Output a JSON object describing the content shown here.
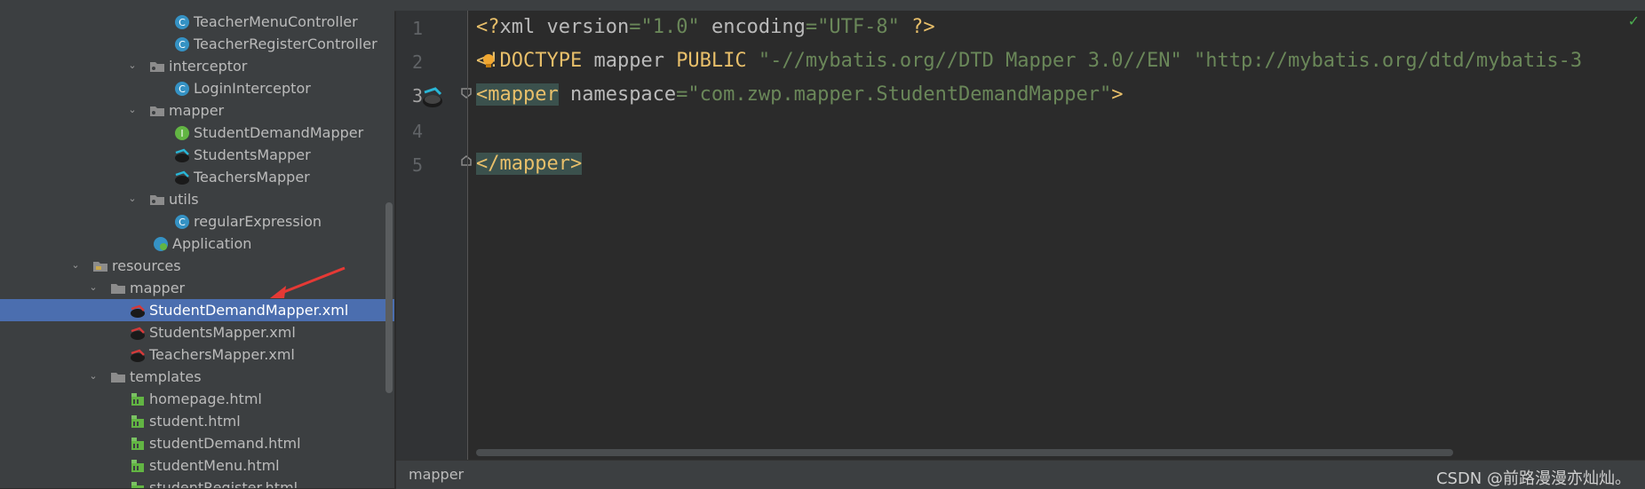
{
  "tree": [
    {
      "label": "TeacherMenuController",
      "indent": 196,
      "icon": "class-icon",
      "arrow": "",
      "selected": false
    },
    {
      "label": "TeacherRegisterController",
      "indent": 196,
      "icon": "class-icon",
      "arrow": "",
      "selected": false
    },
    {
      "label": "interceptor",
      "indent": 168,
      "icon": "package-folder-icon",
      "arrow": "v",
      "selected": false
    },
    {
      "label": "LoginInterceptor",
      "indent": 196,
      "icon": "class-icon",
      "arrow": "",
      "selected": false
    },
    {
      "label": "mapper",
      "indent": 168,
      "icon": "package-folder-icon",
      "arrow": "v",
      "selected": false
    },
    {
      "label": "StudentDemandMapper",
      "indent": 196,
      "icon": "interface-icon",
      "arrow": "",
      "selected": false
    },
    {
      "label": "StudentsMapper",
      "indent": 196,
      "icon": "mybatis-mapper-icon",
      "arrow": "",
      "selected": false
    },
    {
      "label": "TeachersMapper",
      "indent": 196,
      "icon": "mybatis-mapper-icon",
      "arrow": "",
      "selected": false
    },
    {
      "label": "utils",
      "indent": 168,
      "icon": "package-folder-icon",
      "arrow": "v",
      "selected": false
    },
    {
      "label": "regularExpression",
      "indent": 196,
      "icon": "class-icon",
      "arrow": "",
      "selected": false
    },
    {
      "label": "Application",
      "indent": 172,
      "icon": "spring-boot-app-icon",
      "arrow": "",
      "selected": false
    },
    {
      "label": "resources",
      "indent": 104,
      "icon": "resources-folder-icon",
      "arrow": "v",
      "selected": false
    },
    {
      "label": "mapper",
      "indent": 124,
      "icon": "folder-icon",
      "arrow": "v",
      "selected": false
    },
    {
      "label": "StudentDemandMapper.xml",
      "indent": 146,
      "icon": "mybatis-xml-icon",
      "arrow": "",
      "selected": true
    },
    {
      "label": "StudentsMapper.xml",
      "indent": 146,
      "icon": "mybatis-xml-icon",
      "arrow": "",
      "selected": false
    },
    {
      "label": "TeachersMapper.xml",
      "indent": 146,
      "icon": "mybatis-xml-icon",
      "arrow": "",
      "selected": false
    },
    {
      "label": "templates",
      "indent": 124,
      "icon": "folder-icon",
      "arrow": "v",
      "selected": false
    },
    {
      "label": "homepage.html",
      "indent": 146,
      "icon": "html-file-icon",
      "arrow": "",
      "selected": false
    },
    {
      "label": "student.html",
      "indent": 146,
      "icon": "html-file-icon",
      "arrow": "",
      "selected": false
    },
    {
      "label": "studentDemand.html",
      "indent": 146,
      "icon": "html-file-icon",
      "arrow": "",
      "selected": false
    },
    {
      "label": "studentMenu.html",
      "indent": 146,
      "icon": "html-file-icon",
      "arrow": "",
      "selected": false
    },
    {
      "label": "studentRegister.html",
      "indent": 146,
      "icon": "html-file-icon",
      "arrow": "",
      "selected": false
    }
  ],
  "editor": {
    "line_numbers": [
      "1",
      "2",
      "3",
      "4",
      "5"
    ],
    "line1": {
      "p1": "<?",
      "kw": "xml",
      "a1": " version",
      "eq1": "=",
      "s1": "\"1.0\"",
      "a2": " encoding",
      "eq2": "=",
      "s2": "\"UTF-8\"",
      "p2": " ?>"
    },
    "line2": {
      "p1": "<",
      "p2": "!DOCTYPE",
      "kw": " mapper ",
      "kw2": "PUBLIC",
      "s1": " \"-//mybatis.org//DTD Mapper 3.0//EN\"",
      "s2": " \"http://mybatis.org/dtd/mybatis-3"
    },
    "line3": {
      "tag": "<mapper",
      "a1": " namespace",
      "eq": "=",
      "s1": "\"com.zwp.mapper.StudentDemandMapper\"",
      "close": ">"
    },
    "line5": {
      "tag": "</mapper>"
    }
  },
  "status": {
    "breadcrumb": "mapper",
    "watermark": "CSDN @前路漫漫亦灿灿。"
  },
  "colors": {
    "selection": "#4b6eaf",
    "annotation_arrow": "#e53935"
  }
}
